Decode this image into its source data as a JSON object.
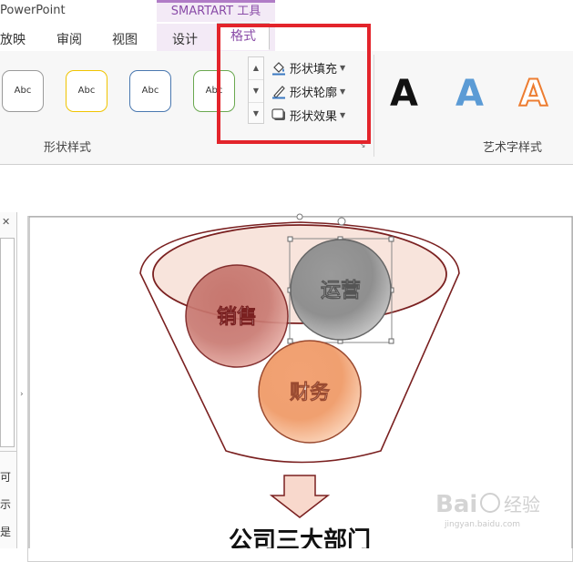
{
  "app": {
    "title": "PowerPoint"
  },
  "context_tab_group": {
    "label": "SMARTART 工具",
    "color": "#8a4ca8"
  },
  "tabs": [
    {
      "label": "放映"
    },
    {
      "label": "审阅"
    },
    {
      "label": "视图"
    },
    {
      "label": "设计"
    },
    {
      "label": "格式",
      "active": true
    }
  ],
  "ribbon": {
    "shape_styles": {
      "label": "形状样式",
      "thumbnails": [
        "Abc",
        "Abc",
        "Abc",
        "Abc"
      ]
    },
    "commands": [
      {
        "label": "形状填充",
        "icon": "paint-bucket-icon"
      },
      {
        "label": "形状轮廓",
        "icon": "pen-icon"
      },
      {
        "label": "形状效果",
        "icon": "shape-effects-icon"
      }
    ],
    "wordart_styles": {
      "label": "艺术字样式",
      "samples": [
        "A",
        "A",
        "A"
      ]
    }
  },
  "highlight_color": "#e3242b",
  "left_panel": {
    "chars": [
      "可",
      "示",
      "是"
    ]
  },
  "diagram": {
    "nodes": [
      {
        "label": "销售",
        "color": "#c97a72"
      },
      {
        "label": "运营",
        "color": "#8f8f8f"
      },
      {
        "label": "财务",
        "color": "#f0a070"
      }
    ],
    "title": "公司三大部门"
  },
  "watermark": {
    "brand": "Bai",
    "brand_cn": "经验",
    "url": "jingyan.baidu.com"
  }
}
